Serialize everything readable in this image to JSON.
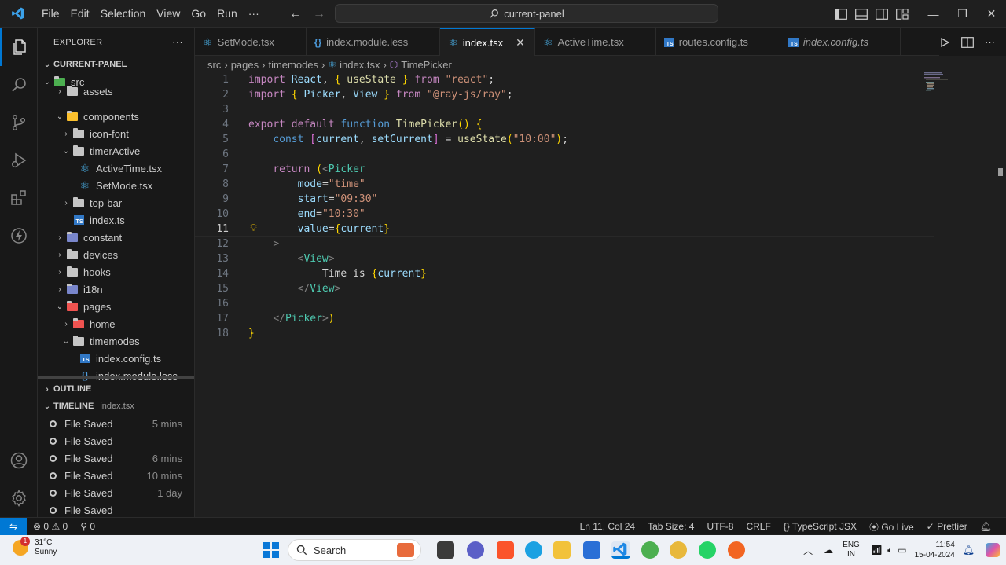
{
  "titlebar": {
    "menu": [
      "File",
      "Edit",
      "Selection",
      "View",
      "Go",
      "Run",
      "···"
    ],
    "command_center": "current-panel"
  },
  "sidebar": {
    "title": "EXPLORER",
    "more": "···",
    "root": "CURRENT-PANEL",
    "tree": [
      {
        "label": "src",
        "indent": 1,
        "kind": "folder-open-src"
      },
      {
        "label": "assets",
        "indent": 2,
        "kind": "folder"
      },
      {
        "label": "components",
        "indent": 2,
        "kind": "folder-open"
      },
      {
        "label": "icon-font",
        "indent": 3,
        "kind": "folder"
      },
      {
        "label": "timerActive",
        "indent": 3,
        "kind": "folder-open"
      },
      {
        "label": "ActiveTime.tsx",
        "indent": 4,
        "kind": "react"
      },
      {
        "label": "SetMode.tsx",
        "indent": 4,
        "kind": "react"
      },
      {
        "label": "top-bar",
        "indent": 3,
        "kind": "folder"
      },
      {
        "label": "index.ts",
        "indent": 3,
        "kind": "ts"
      },
      {
        "label": "constant",
        "indent": 2,
        "kind": "folder"
      },
      {
        "label": "devices",
        "indent": 2,
        "kind": "folder"
      },
      {
        "label": "hooks",
        "indent": 2,
        "kind": "folder"
      },
      {
        "label": "i18n",
        "indent": 2,
        "kind": "folder"
      },
      {
        "label": "pages",
        "indent": 2,
        "kind": "folder-open"
      },
      {
        "label": "home",
        "indent": 3,
        "kind": "folder"
      },
      {
        "label": "timemodes",
        "indent": 3,
        "kind": "folder-open"
      },
      {
        "label": "index.config.ts",
        "indent": 4,
        "kind": "ts"
      },
      {
        "label": "index.module.less",
        "indent": 4,
        "kind": "brace"
      }
    ],
    "outline": "OUTLINE",
    "timeline": {
      "title": "TIMELINE",
      "file": "index.tsx"
    },
    "timeline_items": [
      {
        "label": "File Saved",
        "time": "5 mins"
      },
      {
        "label": "File Saved",
        "time": ""
      },
      {
        "label": "File Saved",
        "time": "6 mins"
      },
      {
        "label": "File Saved",
        "time": "10 mins"
      },
      {
        "label": "File Saved",
        "time": "1 day"
      },
      {
        "label": "File Saved",
        "time": ""
      }
    ]
  },
  "tabs": [
    {
      "label": "SetMode.tsx",
      "kind": "react",
      "active": false
    },
    {
      "label": "index.module.less",
      "kind": "brace",
      "active": false
    },
    {
      "label": "index.tsx",
      "kind": "react",
      "active": true
    },
    {
      "label": "ActiveTime.tsx",
      "kind": "react",
      "active": false
    },
    {
      "label": "routes.config.ts",
      "kind": "ts",
      "active": false
    },
    {
      "label": "index.config.ts",
      "kind": "ts",
      "active": false
    }
  ],
  "breadcrumb": [
    "src",
    "pages",
    "timemodes",
    "index.tsx",
    "TimePicker"
  ],
  "editor": {
    "current_line": 11,
    "lines": [
      "import React, { useState } from \"react\";",
      "import { Picker, View } from \"@ray-js/ray\";",
      "",
      "export default function TimePicker() {",
      "    const [current, setCurrent] = useState(\"10:00\");",
      "",
      "    return (<Picker",
      "        mode=\"time\"",
      "        start=\"09:30\"",
      "        end=\"10:30\"",
      "        value={current}",
      "    >",
      "        <View>",
      "            Time is {current}",
      "        </View>",
      "",
      "    </Picker>)",
      "}"
    ]
  },
  "statusbar": {
    "errors": "0",
    "warnings": "0",
    "ports": "0",
    "position": "Ln 11, Col 24",
    "tab_size": "Tab Size: 4",
    "encoding": "UTF-8",
    "eol": "CRLF",
    "language": "TypeScript JSX",
    "go_live": "Go Live",
    "prettier": "Prettier"
  },
  "taskbar": {
    "temp": "31°C",
    "condition": "Sunny",
    "badge": "1",
    "search": "Search",
    "lang1": "ENG",
    "lang2": "IN",
    "time": "11:54",
    "date": "15-04-2024"
  }
}
